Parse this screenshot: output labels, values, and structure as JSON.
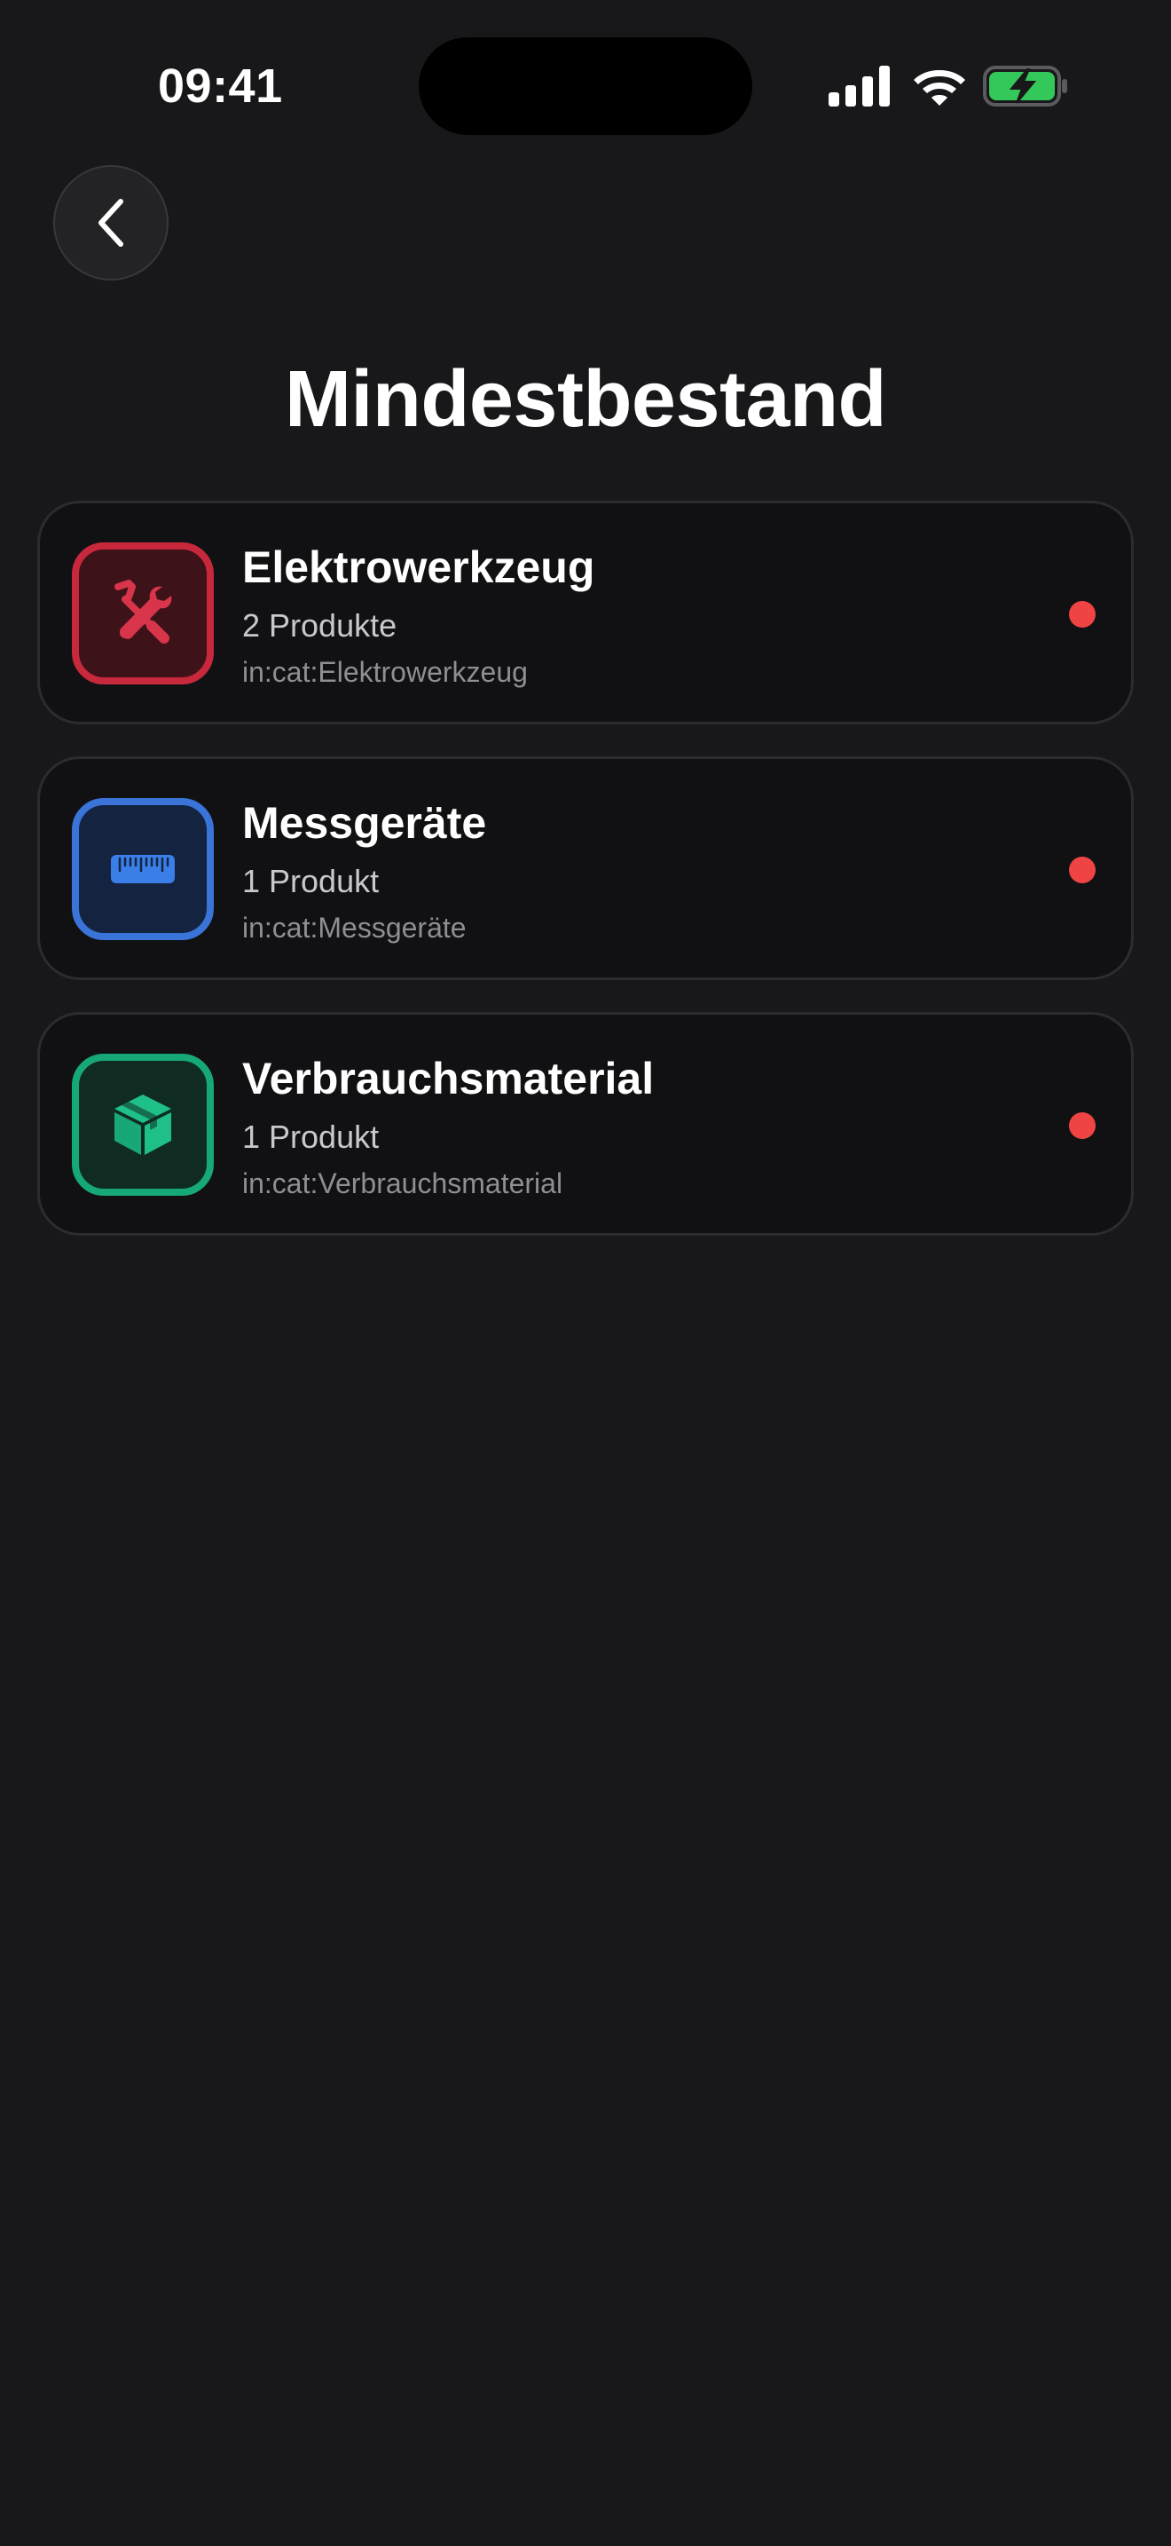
{
  "status_bar": {
    "time": "09:41"
  },
  "header": {
    "back_icon": "chevron-left-icon",
    "title": "Mindestbestand"
  },
  "colors": {
    "background": "#18181a",
    "card_background": "#111113",
    "status_dot": "#f04444"
  },
  "categories": [
    {
      "title": "Elektrowerkzeug",
      "count": "2 Produkte",
      "query": "in:cat:Elektrowerkzeug",
      "icon": "tools-icon",
      "accent": "#c8283c",
      "icon_bg": "#3d1218"
    },
    {
      "title": "Messgeräte",
      "count": "1 Produkt",
      "query": "in:cat:Messgeräte",
      "icon": "ruler-icon",
      "accent": "#3a74d8",
      "icon_bg": "#14233f"
    },
    {
      "title": "Verbrauchsmaterial",
      "count": "1 Produkt",
      "query": "in:cat:Verbrauchsmaterial",
      "icon": "box-icon",
      "accent": "#16a877",
      "icon_bg": "#0f2b22"
    }
  ]
}
